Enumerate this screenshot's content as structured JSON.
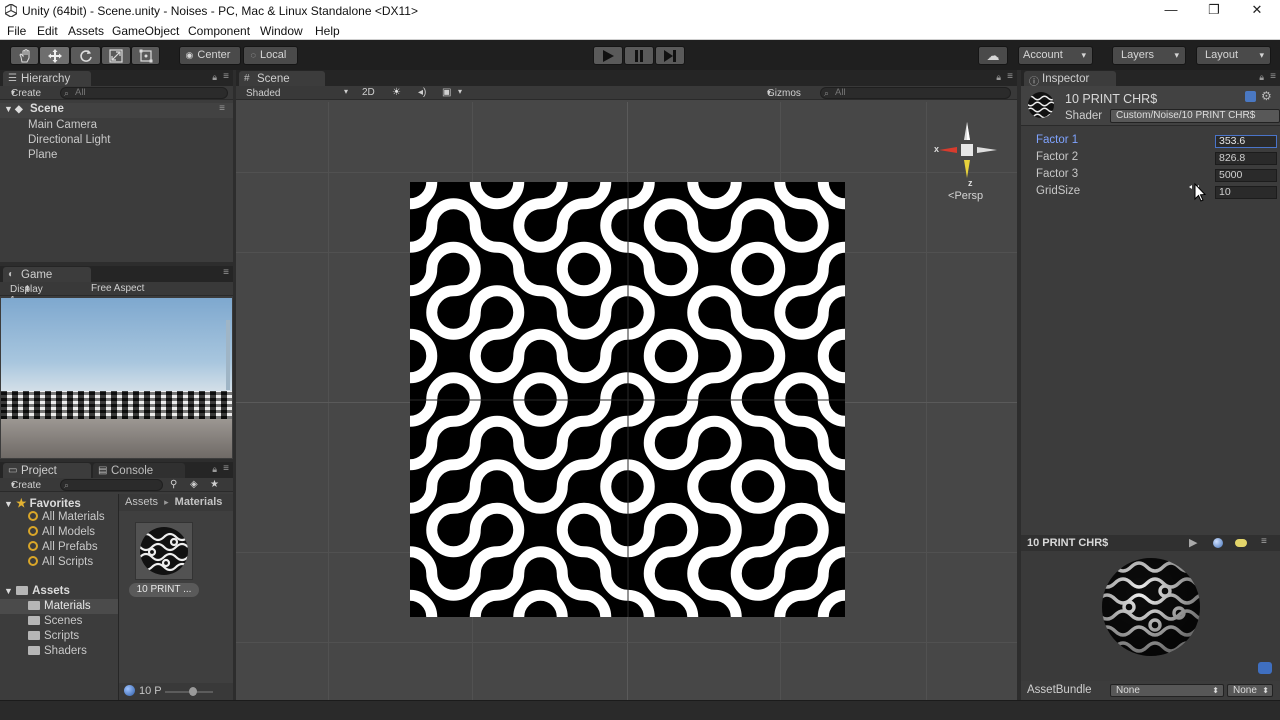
{
  "window": {
    "title": "Unity (64bit) - Scene.unity - Noises - PC, Mac & Linux Standalone <DX11>",
    "minimize": "—",
    "restore": "❐",
    "close": "✕"
  },
  "menu": {
    "items": [
      "File",
      "Edit",
      "Assets",
      "GameObject",
      "Component",
      "Window",
      "Help"
    ]
  },
  "toolbar": {
    "pivot": "Center",
    "space": "Local",
    "account": "Account",
    "layers": "Layers",
    "layout": "Layout",
    "tools": [
      "hand-icon",
      "move-icon",
      "rotate-icon",
      "scale-icon",
      "rect-icon"
    ],
    "play_icons": [
      "play-icon",
      "pause-icon",
      "step-icon"
    ]
  },
  "hierarchy": {
    "tab": "Hierarchy",
    "create": "Create",
    "search_placeholder": "All",
    "scene": "Scene",
    "items": [
      "Main Camera",
      "Directional Light",
      "Plane"
    ]
  },
  "game": {
    "tab": "Game",
    "display": "Display 1",
    "aspect": "Free Aspect"
  },
  "scene_view": {
    "tab": "Scene",
    "shading": "Shaded",
    "mode2d": "2D",
    "gizmos": "Gizmos",
    "search_placeholder": "All",
    "persp": "Persp",
    "axis_x": "x",
    "axis_z": "z"
  },
  "project": {
    "tab": "Project",
    "console_tab": "Console",
    "create": "Create",
    "favorites_label": "Favorites",
    "favorites": [
      "All Materials",
      "All Models",
      "All Prefabs",
      "All Scripts"
    ],
    "assets_label": "Assets",
    "folders": [
      "Materials",
      "Scenes",
      "Scripts",
      "Shaders"
    ],
    "breadcrumb_root": "Assets",
    "breadcrumb_sep": "▸",
    "breadcrumb_current": "Materials",
    "asset_name": "10 PRINT ...",
    "status": "10 P"
  },
  "inspector": {
    "tab": "Inspector",
    "material_name": "10 PRINT CHR$",
    "shader_label": "Shader",
    "shader_value": "Custom/Noise/10 PRINT CHR$",
    "properties": [
      {
        "label": "Factor 1",
        "value": "353.6"
      },
      {
        "label": "Factor 2",
        "value": "826.8"
      },
      {
        "label": "Factor 3",
        "value": "5000"
      },
      {
        "label": "GridSize",
        "value": "10"
      }
    ],
    "preview_title": "10 PRINT CHR$",
    "assetbundle_label": "AssetBundle",
    "assetbundle_value": "None",
    "assetbundle_variant": "None"
  }
}
